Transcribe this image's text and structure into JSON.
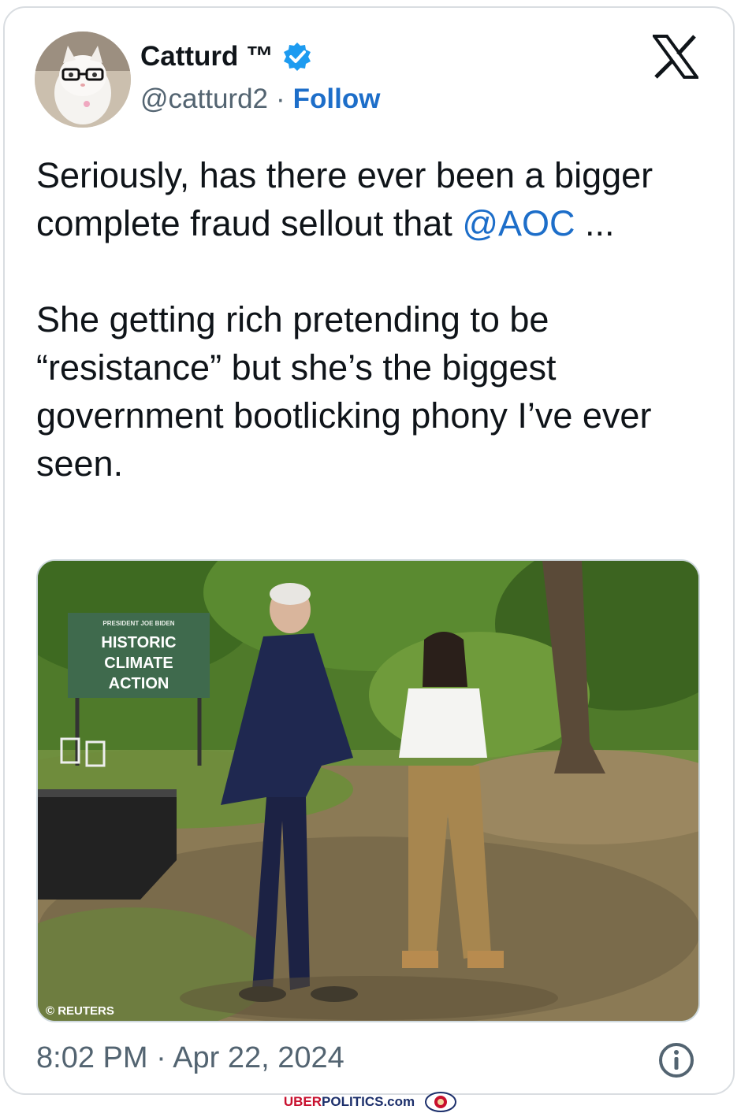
{
  "author": {
    "display_name": "Catturd ™",
    "handle": "@catturd2",
    "separator": "·",
    "follow_label": "Follow",
    "verified": true
  },
  "tweet": {
    "text_part1": "Seriously, has there ever been a bigger complete fraud sellout that ",
    "mention": "@AOC",
    "text_part2": " ...\n\nShe getting rich pretending to be “resistance” but she’s the biggest government bootlicking phony I’ve ever seen."
  },
  "media": {
    "sign_small": "PRESIDENT JOE BIDEN",
    "sign_line1": "HISTORIC",
    "sign_line2": "CLIMATE",
    "sign_line3": "ACTION",
    "credit": "© REUTERS"
  },
  "timestamp": "8:02 PM · Apr 22, 2024",
  "footer": {
    "brand_part1": "UBER",
    "brand_part2": "POLITICS.com"
  },
  "colors": {
    "link": "#1d6ec9",
    "verified": "#1d9bf0",
    "text": "#0f1419",
    "muted": "#536471"
  },
  "icons": [
    "verified-badge-icon",
    "x-logo-icon",
    "info-icon"
  ]
}
